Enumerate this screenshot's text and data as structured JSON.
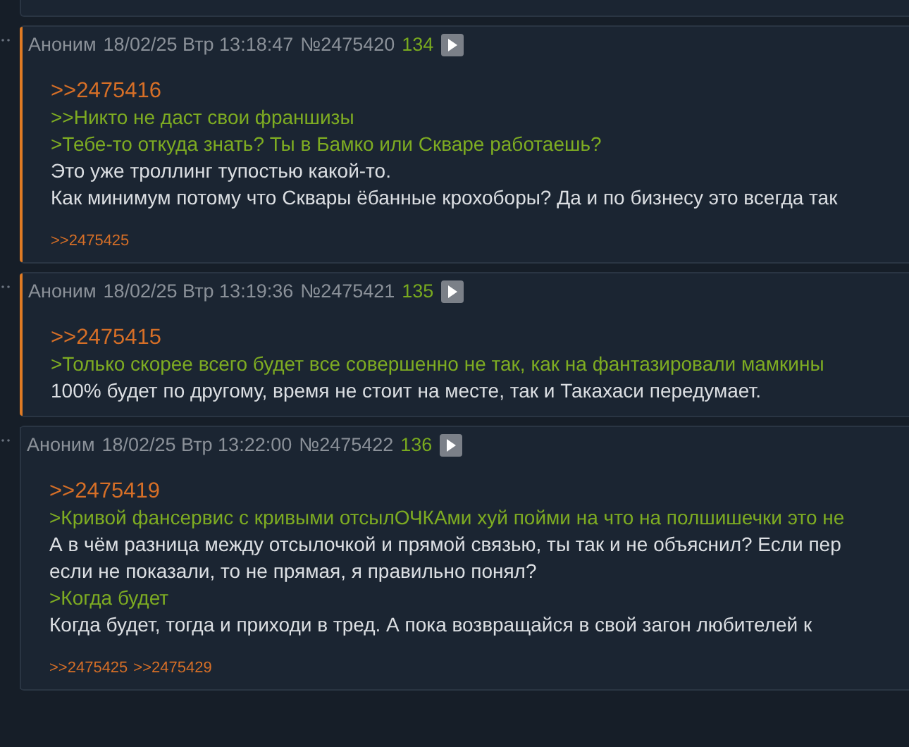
{
  "posts": [
    {
      "author": "Аноним",
      "date": "18/02/25 Втр 13:18:47",
      "number": "№2475420",
      "count": "134",
      "highlighted": true,
      "lines": [
        {
          "kind": "reply",
          "text": ">>2475416"
        },
        {
          "kind": "quote",
          "text": ">>Никто не даст свои франшизы"
        },
        {
          "kind": "quote",
          "text": ">Тебе-то откуда знать? Ты в Бамко или Скваре работаешь?"
        },
        {
          "kind": "plain",
          "text": "Это уже троллинг тупостью какой-то."
        },
        {
          "kind": "plain",
          "text": "Как минимум потому что Сквары ёбанные крохоборы? Да и по бизнесу это всегда так"
        }
      ],
      "backlinks": [
        ">>2475425"
      ]
    },
    {
      "author": "Аноним",
      "date": "18/02/25 Втр 13:19:36",
      "number": "№2475421",
      "count": "135",
      "highlighted": true,
      "lines": [
        {
          "kind": "reply",
          "text": ">>2475415"
        },
        {
          "kind": "quote",
          "text": ">Только скорее всего будет все совершенно не так, как на фантазировали мамкины"
        },
        {
          "kind": "plain",
          "text": "100% будет по другому, время не стоит на месте, так и Такахаси передумает."
        }
      ]
    },
    {
      "author": "Аноним",
      "date": "18/02/25 Втр 13:22:00",
      "number": "№2475422",
      "count": "136",
      "highlighted": false,
      "lines": [
        {
          "kind": "reply",
          "text": ">>2475419"
        },
        {
          "kind": "quote",
          "text": ">Кривой фансервис с кривыми отсылОЧКАми хуй пойми на что на полшишечки это не"
        },
        {
          "kind": "plain",
          "text": "А в чём разница между отсылочкой и прямой связью, ты так и не объяснил? Если пер"
        },
        {
          "kind": "plain",
          "text": "если не показали, то не прямая, я правильно понял?"
        },
        {
          "kind": "quote",
          "text": ">Когда будет"
        },
        {
          "kind": "plain",
          "text": "Когда будет, тогда и приходи в тред. А пока возвращайся в свой загон любителей к"
        }
      ],
      "backlinks": [
        ">>2475425",
        ">>2475429"
      ]
    }
  ]
}
